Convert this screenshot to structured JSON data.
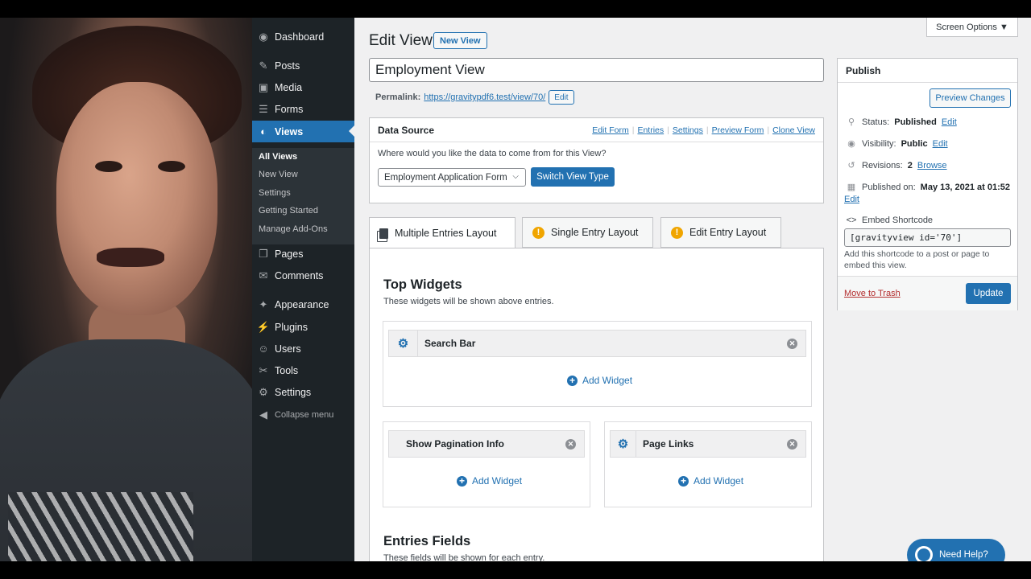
{
  "sidebar": {
    "items": [
      {
        "label": "Dashboard",
        "icon": "dashboard-icon",
        "glyph": "◉"
      },
      {
        "label": "Posts",
        "icon": "pin-icon",
        "glyph": "✎"
      },
      {
        "label": "Media",
        "icon": "media-icon",
        "glyph": "▣"
      },
      {
        "label": "Forms",
        "icon": "forms-icon",
        "glyph": "☰"
      },
      {
        "label": "Views",
        "icon": "views-icon",
        "glyph": "◐"
      },
      {
        "label": "Pages",
        "icon": "pages-icon",
        "glyph": "❐"
      },
      {
        "label": "Comments",
        "icon": "comments-icon",
        "glyph": "✉"
      },
      {
        "label": "Appearance",
        "icon": "appearance-icon",
        "glyph": "✦"
      },
      {
        "label": "Plugins",
        "icon": "plugins-icon",
        "glyph": "⚡"
      },
      {
        "label": "Users",
        "icon": "users-icon",
        "glyph": "☺"
      },
      {
        "label": "Tools",
        "icon": "tools-icon",
        "glyph": "✂"
      },
      {
        "label": "Settings",
        "icon": "settings-icon",
        "glyph": "⚙"
      }
    ],
    "submenu": [
      "All Views",
      "New View",
      "Settings",
      "Getting Started",
      "Manage Add-Ons"
    ],
    "collapse_label": "Collapse menu",
    "collapse_glyph": "◀"
  },
  "header": {
    "screen_options": "Screen Options ▼",
    "title": "Edit View",
    "new_view": "New View"
  },
  "post": {
    "title": "Employment View",
    "permalink_label": "Permalink:",
    "permalink_url": "https://gravitypdf6.test/view/70/",
    "permalink_edit": "Edit"
  },
  "data_source": {
    "heading": "Data Source",
    "links": [
      "Edit Form",
      "Entries",
      "Settings",
      "Preview Form",
      "Clone View"
    ],
    "question": "Where would you like the data to come from for this View?",
    "form_selected": "Employment Application Form",
    "chevron": "⌵",
    "switch_button": "Switch View Type"
  },
  "tabs": [
    {
      "label": "Multiple Entries Layout"
    },
    {
      "label": "Single Entry Layout",
      "badge": "!"
    },
    {
      "label": "Edit Entry Layout",
      "badge": "!"
    }
  ],
  "layout": {
    "top_widgets_title": "Top Widgets",
    "top_widgets_desc": "These widgets will be shown above entries.",
    "widget_search": "Search Bar",
    "widget_pagination": "Show Pagination Info",
    "widget_page_links": "Page Links",
    "add_widget": "Add Widget",
    "entries_fields_title": "Entries Fields",
    "entries_fields_desc": "These fields will be shown for each entry.",
    "gear_glyph": "⚙",
    "close_glyph": "✕",
    "plus_glyph": "+"
  },
  "publish": {
    "heading": "Publish",
    "preview": "Preview Changes",
    "status_label": "Status:",
    "status_value": "Published",
    "visibility_label": "Visibility:",
    "visibility_value": "Public",
    "revisions_label": "Revisions:",
    "revisions_value": "2",
    "browse": "Browse",
    "published_label": "Published on:",
    "published_value": "May 13, 2021 at 01:52",
    "edit": "Edit",
    "embed_label": "Embed Shortcode",
    "shortcode": "[gravityview id='70']",
    "shortcode_help": "Add this shortcode to a post or page to embed this view.",
    "trash": "Move to Trash",
    "update": "Update",
    "glyphs": {
      "status": "⚲",
      "visibility": "◉",
      "revisions": "↺",
      "calendar": "▦",
      "embed": "<>"
    }
  },
  "help": {
    "label": "Need Help?"
  },
  "colors": {
    "accent": "#2271b1",
    "sidebar": "#1d2327",
    "warning": "#f0a500",
    "danger": "#b32d2e"
  }
}
